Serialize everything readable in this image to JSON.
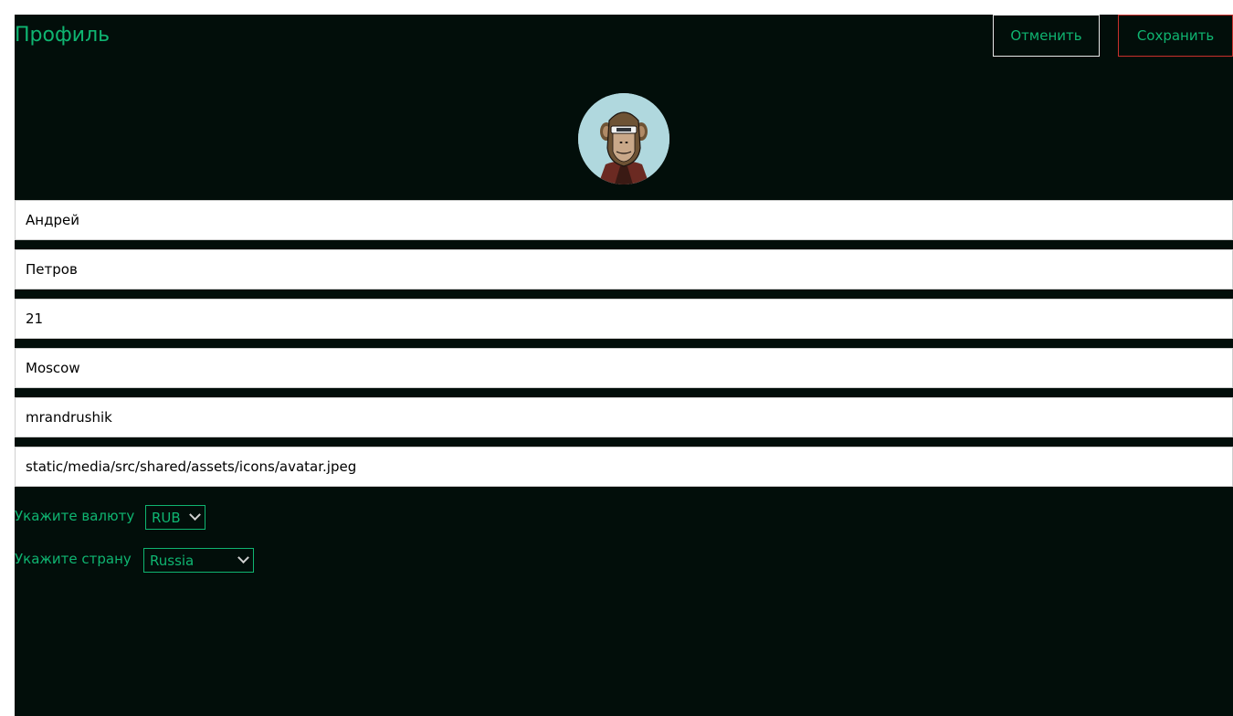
{
  "header": {
    "title": "Профиль",
    "cancel_label": "Отменить",
    "save_label": "Сохранить"
  },
  "profile": {
    "first_name": "Андрей",
    "last_name": "Петров",
    "age": "21",
    "city": "Moscow",
    "username": "mrandrushik",
    "avatar_path": "static/media/src/shared/assets/icons/avatar.jpeg"
  },
  "currency": {
    "label": "Укажите валюту",
    "selected": "RUB"
  },
  "country": {
    "label": "Укажите страну",
    "selected": "Russia"
  },
  "colors": {
    "background": "#020e0a",
    "accent": "#0fb571",
    "save_border": "#c9302c",
    "cancel_border": "#e8e8e8"
  },
  "icons": {
    "avatar": "ape-avatar-image",
    "select_arrow": "chevron-down-icon"
  }
}
